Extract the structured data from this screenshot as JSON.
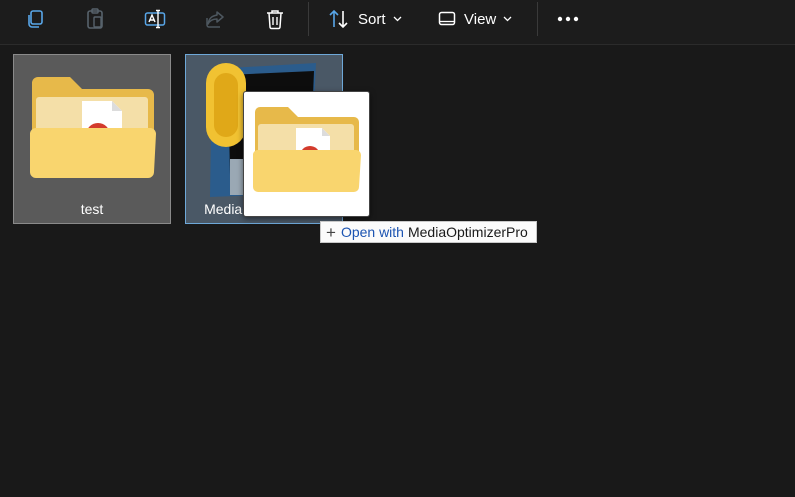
{
  "toolbar": {
    "sort_label": "Sort",
    "view_label": "View"
  },
  "files": [
    {
      "name": "test"
    },
    {
      "name": "MediaOptimizerPro"
    }
  ],
  "drag_tooltip": {
    "action": "Open with",
    "target": "MediaOptimizerPro"
  }
}
